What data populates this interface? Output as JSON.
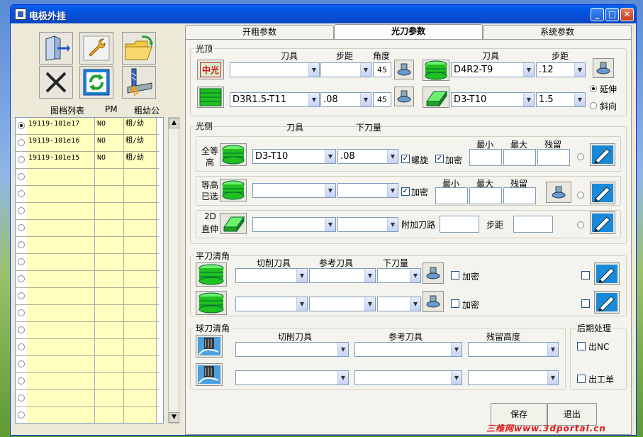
{
  "window": {
    "title": "电极外挂"
  },
  "titlebar": {
    "minimize": "_",
    "maximize": "□",
    "close": "✕"
  },
  "left": {
    "headers": {
      "list": "图档列表",
      "pm": "PM",
      "rough": "粗幼公"
    },
    "rows": [
      {
        "name": "19119-101e17",
        "pm": "NO",
        "rough": "粗/幼"
      },
      {
        "name": "19119-101e16",
        "pm": "NO",
        "rough": "粗/幼"
      },
      {
        "name": "19119-101e15",
        "pm": "NO",
        "rough": "粗/幼"
      }
    ],
    "scroll": {
      "up": "▲",
      "down": "▼"
    }
  },
  "tabs": [
    {
      "label": "开粗参数"
    },
    {
      "label": "光刀参数"
    },
    {
      "label": "系统参数"
    }
  ],
  "top": {
    "group": "光顶",
    "col_tool": "刀具",
    "col_step": "步距",
    "col_angle": "角度",
    "col_tool2": "刀具",
    "col_step2": "步距",
    "icon_label": "中光",
    "row1": {
      "tool": "",
      "step": "",
      "angle": "45",
      "tool2": "D4R2-T9",
      "step2": ".12"
    },
    "row2": {
      "tool": "D3R1.5-T11",
      "step": ".08",
      "angle": "45",
      "tool2": "D3-T10",
      "step2": "1.5"
    },
    "opt_extend": "延伸",
    "opt_slope": "斜向"
  },
  "side": {
    "group": "光侧",
    "col_tool": "刀具",
    "col_depth": "下刀量",
    "row1": {
      "label1": "全等",
      "label2": "高",
      "tool": "D3-T10",
      "depth": ".08",
      "spiral": "螺旋",
      "dense": "加密",
      "min": "最小",
      "max": "最大",
      "remain": "残留"
    },
    "row2": {
      "label1": "等高",
      "label2": "已选",
      "tool": "",
      "depth": "",
      "dense": "加密",
      "min": "最小",
      "max": "最大",
      "remain": "残留"
    },
    "row3": {
      "label1": "2D",
      "label2": "直伸",
      "tool": "",
      "depth": "",
      "extra": "附加刀路",
      "step": "步距"
    }
  },
  "flat": {
    "group": "平刀清角",
    "col_cut": "切削刀具",
    "col_ref": "参考刀具",
    "col_depth": "下刀量",
    "dense1": "加密",
    "dense2": "加密"
  },
  "ball": {
    "group": "球刀清角",
    "col_cut": "切削刀具",
    "col_ref": "参考刀具",
    "col_remain": "残留高度"
  },
  "post": {
    "group": "后期处理",
    "nc": "出NC",
    "sheet": "出工单"
  },
  "buttons": {
    "save": "保存",
    "exit": "退出"
  },
  "watermark": "三维网www.3dportal.cn"
}
